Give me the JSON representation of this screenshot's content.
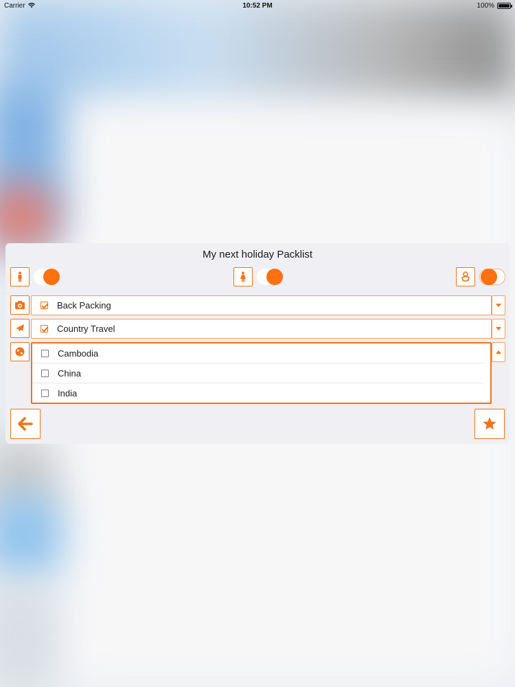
{
  "status_bar": {
    "carrier": "Carrier",
    "time": "10:52 PM",
    "battery": "100%"
  },
  "dialog": {
    "title": "My next holiday Packlist",
    "toggles": [
      {
        "icon": "man-icon",
        "on": true
      },
      {
        "icon": "woman-icon",
        "on": true
      },
      {
        "icon": "baby-icon",
        "on": true
      }
    ],
    "categories": [
      {
        "icon": "camera-icon",
        "label": "Back Packing",
        "checked": true,
        "expanded": false
      },
      {
        "icon": "airplane-icon",
        "label": "Country Travel",
        "checked": true,
        "expanded": false
      }
    ],
    "destination_list": {
      "icon": "globe-icon",
      "expanded": true,
      "items": [
        {
          "label": "Cambodia",
          "checked": false
        },
        {
          "label": "China",
          "checked": false
        },
        {
          "label": "India",
          "checked": false
        }
      ]
    },
    "footer": {
      "back_icon": "arrow-left-icon",
      "favorite_icon": "star-icon"
    }
  },
  "colors": {
    "accent": "#ff7011",
    "border": "#f07419",
    "dialog_bg": "#efeff4"
  }
}
